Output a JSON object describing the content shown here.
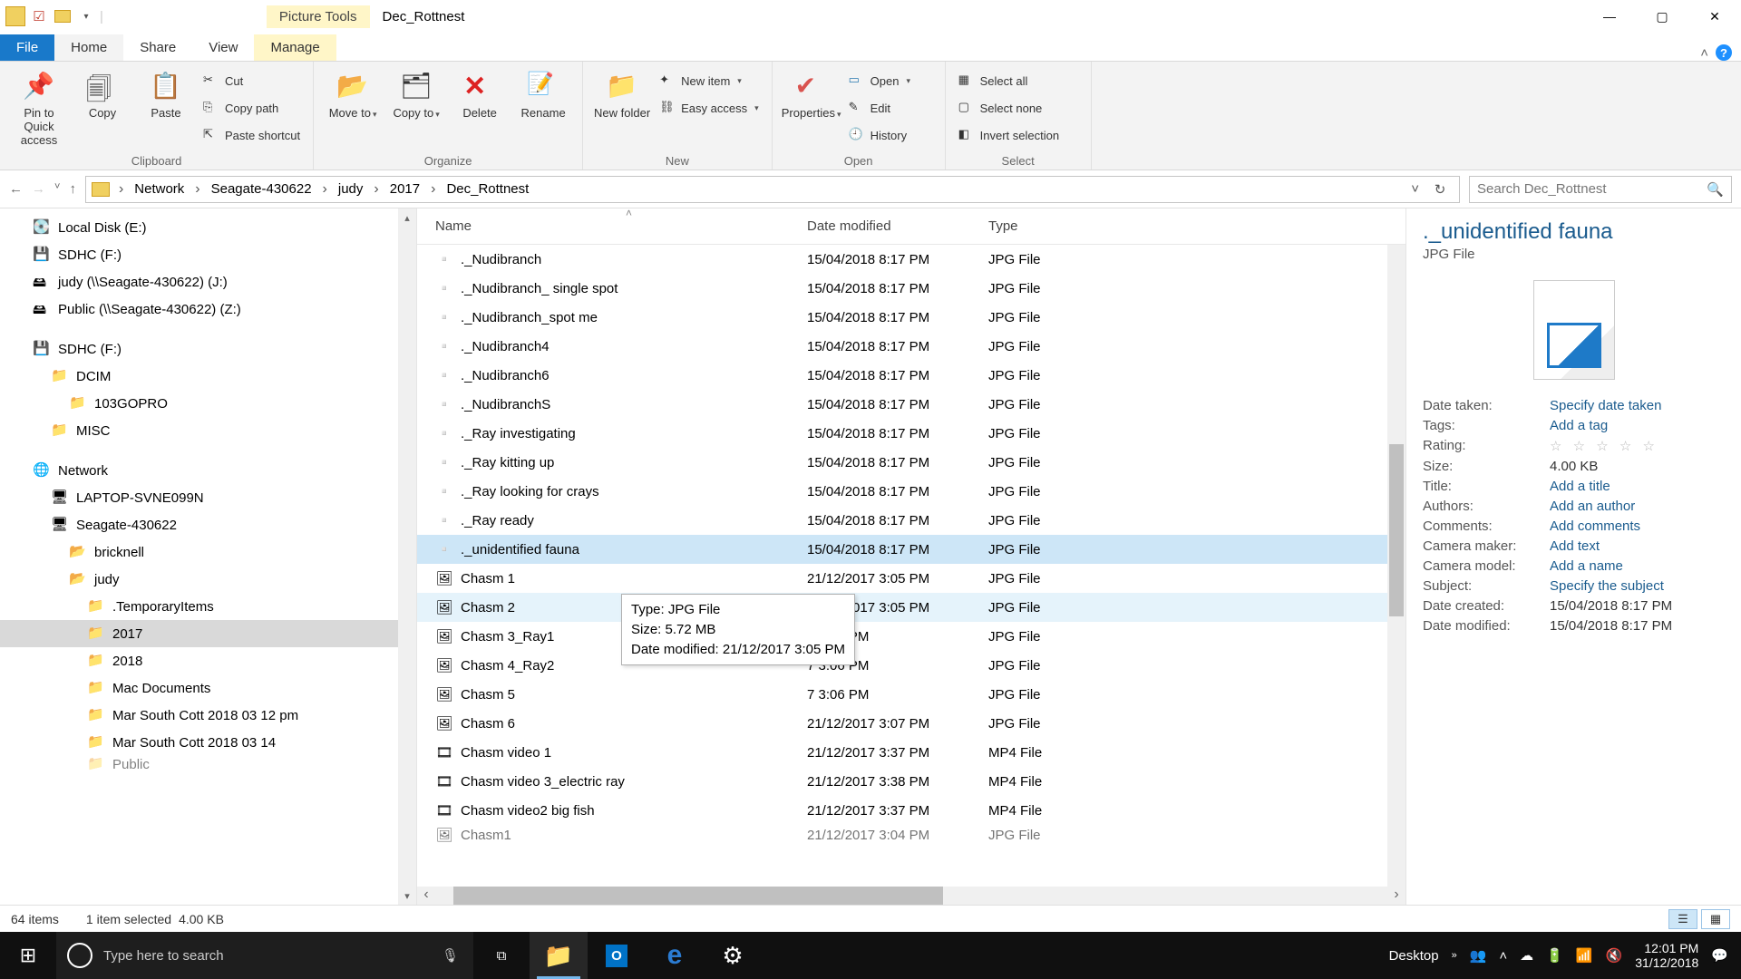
{
  "window": {
    "title": "Dec_Rottnest",
    "contextual_tab": "Picture Tools",
    "controls": {
      "minimize": "—",
      "maximize": "▢",
      "close": "✕"
    }
  },
  "ribbon_tabs": {
    "file": "File",
    "home": "Home",
    "share": "Share",
    "view": "View",
    "manage": "Manage"
  },
  "ribbon": {
    "clipboard": {
      "label": "Clipboard",
      "pin": "Pin to Quick access",
      "copy": "Copy",
      "paste": "Paste",
      "cut": "Cut",
      "copypath": "Copy path",
      "pasteshort": "Paste shortcut"
    },
    "organize": {
      "label": "Organize",
      "moveto": "Move to",
      "copyto": "Copy to",
      "delete": "Delete",
      "rename": "Rename"
    },
    "new": {
      "label": "New",
      "newfolder": "New folder",
      "newitem": "New item",
      "easyaccess": "Easy access"
    },
    "open": {
      "label": "Open",
      "properties": "Properties",
      "open": "Open",
      "edit": "Edit",
      "history": "History"
    },
    "select": {
      "label": "Select",
      "all": "Select all",
      "none": "Select none",
      "invert": "Invert selection"
    }
  },
  "breadcrumb": [
    "Network",
    "Seagate-430622",
    "judy",
    "2017",
    "Dec_Rottnest"
  ],
  "search_placeholder": "Search Dec_Rottnest",
  "tree": [
    {
      "label": "Local Disk (E:)",
      "indent": 0,
      "icon": "disk"
    },
    {
      "label": "SDHC (F:)",
      "indent": 0,
      "icon": "sd"
    },
    {
      "label": "judy (\\\\Seagate-430622) (J:)",
      "indent": 0,
      "icon": "netx"
    },
    {
      "label": "Public (\\\\Seagate-430622) (Z:)",
      "indent": 0,
      "icon": "netx"
    },
    {
      "label": "",
      "indent": 0,
      "spacer": true
    },
    {
      "label": "SDHC (F:)",
      "indent": 0,
      "icon": "sd"
    },
    {
      "label": "DCIM",
      "indent": 1,
      "icon": "folder"
    },
    {
      "label": "103GOPRO",
      "indent": 2,
      "icon": "folder"
    },
    {
      "label": "MISC",
      "indent": 1,
      "icon": "folder"
    },
    {
      "label": "",
      "indent": 0,
      "spacer": true
    },
    {
      "label": "Network",
      "indent": 0,
      "icon": "net"
    },
    {
      "label": "LAPTOP-SVNE099N",
      "indent": 1,
      "icon": "pc"
    },
    {
      "label": "Seagate-430622",
      "indent": 1,
      "icon": "pc"
    },
    {
      "label": "bricknell",
      "indent": 2,
      "icon": "share"
    },
    {
      "label": "judy",
      "indent": 2,
      "icon": "share"
    },
    {
      "label": ".TemporaryItems",
      "indent": 3,
      "icon": "folder"
    },
    {
      "label": "2017",
      "indent": 3,
      "icon": "folder",
      "selected": true
    },
    {
      "label": "2018",
      "indent": 3,
      "icon": "folder"
    },
    {
      "label": "Mac Documents",
      "indent": 3,
      "icon": "folder"
    },
    {
      "label": "Mar South Cott 2018 03 12 pm",
      "indent": 3,
      "icon": "folder"
    },
    {
      "label": "Mar South Cott 2018 03 14",
      "indent": 3,
      "icon": "folder"
    },
    {
      "label": "Public",
      "indent": 3,
      "icon": "folder",
      "cut": true
    }
  ],
  "columns": {
    "name": "Name",
    "date": "Date modified",
    "type": "Type"
  },
  "files": [
    {
      "name": "._Nudibranch",
      "date": "15/04/2018 8:17 PM",
      "type": "JPG File",
      "icon": "sys"
    },
    {
      "name": "._Nudibranch_ single spot",
      "date": "15/04/2018 8:17 PM",
      "type": "JPG File",
      "icon": "sys"
    },
    {
      "name": "._Nudibranch_spot me",
      "date": "15/04/2018 8:17 PM",
      "type": "JPG File",
      "icon": "sys"
    },
    {
      "name": "._Nudibranch4",
      "date": "15/04/2018 8:17 PM",
      "type": "JPG File",
      "icon": "sys"
    },
    {
      "name": "._Nudibranch6",
      "date": "15/04/2018 8:17 PM",
      "type": "JPG File",
      "icon": "sys"
    },
    {
      "name": "._NudibranchS",
      "date": "15/04/2018 8:17 PM",
      "type": "JPG File",
      "icon": "sys"
    },
    {
      "name": "._Ray investigating",
      "date": "15/04/2018 8:17 PM",
      "type": "JPG File",
      "icon": "sys"
    },
    {
      "name": "._Ray kitting up",
      "date": "15/04/2018 8:17 PM",
      "type": "JPG File",
      "icon": "sys"
    },
    {
      "name": "._Ray looking for crays",
      "date": "15/04/2018 8:17 PM",
      "type": "JPG File",
      "icon": "sys"
    },
    {
      "name": "._Ray ready",
      "date": "15/04/2018 8:17 PM",
      "type": "JPG File",
      "icon": "sys"
    },
    {
      "name": "._unidentified fauna",
      "date": "15/04/2018 8:17 PM",
      "type": "JPG File",
      "icon": "sys",
      "selected": true
    },
    {
      "name": "Chasm 1",
      "date": "21/12/2017 3:05 PM",
      "type": "JPG File",
      "icon": "jpg"
    },
    {
      "name": "Chasm 2",
      "date": "21/12/2017 3:05 PM",
      "type": "JPG File",
      "icon": "jpg",
      "hover": true
    },
    {
      "name": "Chasm 3_Ray1",
      "date": "21/12/2017 3:05 PM",
      "type": "JPG File",
      "icon": "jpg",
      "date_obscured": "7 3:05 PM"
    },
    {
      "name": "Chasm 4_Ray2",
      "date": "21/12/2017 3:06 PM",
      "type": "JPG File",
      "icon": "jpg",
      "date_obscured": "7 3:06 PM"
    },
    {
      "name": "Chasm 5",
      "date": "21/12/2017 3:06 PM",
      "type": "JPG File",
      "icon": "jpg",
      "date_obscured": "7 3:06 PM"
    },
    {
      "name": "Chasm 6",
      "date": "21/12/2017 3:07 PM",
      "type": "JPG File",
      "icon": "jpg"
    },
    {
      "name": "Chasm video 1",
      "date": "21/12/2017 3:37 PM",
      "type": "MP4 File",
      "icon": "mp4"
    },
    {
      "name": "Chasm video 3_electric ray",
      "date": "21/12/2017 3:38 PM",
      "type": "MP4 File",
      "icon": "mp4"
    },
    {
      "name": "Chasm video2 big fish",
      "date": "21/12/2017 3:37 PM",
      "type": "MP4 File",
      "icon": "mp4"
    },
    {
      "name": "Chasm1",
      "date": "21/12/2017 3:04 PM",
      "type": "JPG File",
      "icon": "jpg",
      "cut": true
    }
  ],
  "tooltip": {
    "l1": "Type: JPG File",
    "l2": "Size: 5.72 MB",
    "l3": "Date modified: 21/12/2017 3:05 PM"
  },
  "details": {
    "title": "._unidentified fauna",
    "subtitle": "JPG File",
    "rows": [
      {
        "label": "Date taken:",
        "value": "Specify date taken",
        "link": true
      },
      {
        "label": "Tags:",
        "value": "Add a tag",
        "link": true
      },
      {
        "label": "Rating:",
        "value": "☆ ☆ ☆ ☆ ☆",
        "stars": true
      },
      {
        "label": "Size:",
        "value": "4.00 KB"
      },
      {
        "label": "Title:",
        "value": "Add a title",
        "link": true
      },
      {
        "label": "Authors:",
        "value": "Add an author",
        "link": true
      },
      {
        "label": "Comments:",
        "value": "Add comments",
        "link": true
      },
      {
        "label": "Camera maker:",
        "value": "Add text",
        "link": true
      },
      {
        "label": "Camera model:",
        "value": "Add a name",
        "link": true
      },
      {
        "label": "Subject:",
        "value": "Specify the subject",
        "link": true
      },
      {
        "label": "Date created:",
        "value": "15/04/2018 8:17 PM"
      },
      {
        "label": "Date modified:",
        "value": "15/04/2018 8:17 PM"
      }
    ]
  },
  "status": {
    "count": "64 items",
    "selection": "1 item selected",
    "size": "4.00 KB"
  },
  "taskbar": {
    "search": "Type here to search",
    "desktop": "Desktop",
    "time": "12:01 PM",
    "date": "31/12/2018"
  }
}
